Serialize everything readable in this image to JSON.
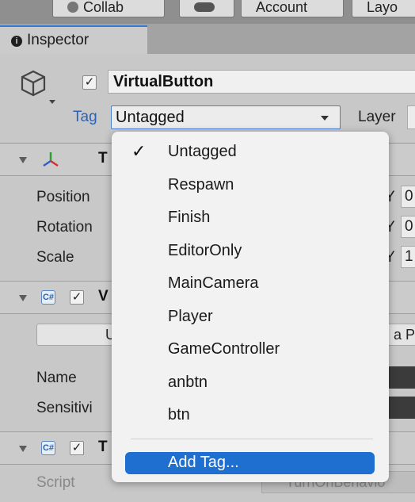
{
  "toolbar": {
    "buttons": [
      "Collab",
      "",
      "Account",
      "Layo"
    ]
  },
  "inspector": {
    "tab_label": "Inspector",
    "object_name": "VirtualButton",
    "object_active": true,
    "tag_label": "Tag",
    "tag_value": "Untagged",
    "layer_label": "Layer"
  },
  "transform": {
    "title_partial": "T",
    "rows": [
      {
        "label": "Position",
        "axis": "Y",
        "value": "0"
      },
      {
        "label": "Rotation",
        "axis": "Y",
        "value": "0"
      },
      {
        "label": "Scale",
        "axis": "Y",
        "value": "1"
      }
    ]
  },
  "component1": {
    "title_partial": "V",
    "button_left": "U",
    "button_right": "a P",
    "rows": [
      {
        "label": "Name"
      },
      {
        "label": "Sensitivi"
      }
    ]
  },
  "component2": {
    "title_partial": "T",
    "script_label": "Script",
    "script_value": "TurnOnBehavio"
  },
  "tag_menu": {
    "selected": "Untagged",
    "items": [
      "Untagged",
      "Respawn",
      "Finish",
      "EditorOnly",
      "MainCamera",
      "Player",
      "GameController",
      "anbtn",
      "btn"
    ],
    "add_label": "Add Tag..."
  },
  "colors": {
    "accent": "#1f6fd1",
    "tag_label": "#2a62b8",
    "panel": "#c8c8c8",
    "menu": "#f2f2f2"
  }
}
